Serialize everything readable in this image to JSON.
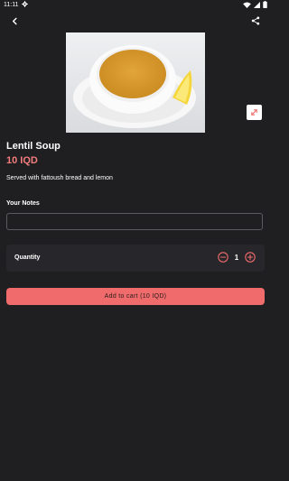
{
  "status_bar": {
    "time": "11:11"
  },
  "item": {
    "name": "Lentil Soup",
    "price": "10 IQD",
    "description": "Served with fattoush bread and lemon",
    "image_icon": "soup-bowl-photo"
  },
  "notes": {
    "label": "Your Notes",
    "value": "",
    "placeholder": ""
  },
  "quantity": {
    "label": "Quantity",
    "value": "1"
  },
  "cart_button": {
    "label": "Add to cart (10 IQD)"
  },
  "colors": {
    "background": "#1f1f22",
    "accent": "#f06b6b",
    "price": "#f47d7d",
    "card": "#27272b"
  }
}
